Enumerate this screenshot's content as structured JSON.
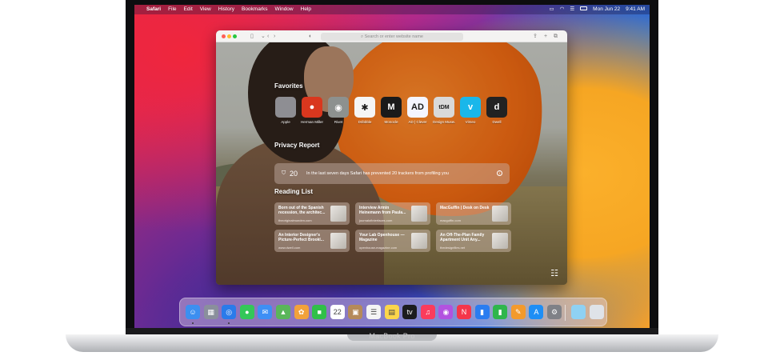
{
  "menubar": {
    "apple_glyph": "",
    "app_name": "Safari",
    "items": [
      "File",
      "Edit",
      "View",
      "History",
      "Bookmarks",
      "Window",
      "Help"
    ],
    "date": "Mon Jun 22",
    "time": "9:41 AM"
  },
  "safari": {
    "address_placeholder": "Search or enter website name",
    "favorites_title": "Favorites",
    "favorites": [
      {
        "label": "Apple",
        "glyph": "",
        "color": "#8e8e93"
      },
      {
        "label": "Herman Miller",
        "glyph": "●",
        "color": "#d9371e"
      },
      {
        "label": "Rivet",
        "glyph": "◉",
        "color": "#8d918f"
      },
      {
        "label": "Dribbble",
        "glyph": "✱",
        "color": "#f5f5f5"
      },
      {
        "label": "Monocle",
        "glyph": "M",
        "color": "#1a1a1a"
      },
      {
        "label": "AD | Clever",
        "glyph": "AD",
        "color": "#f4f5ff"
      },
      {
        "label": "Design Museum",
        "glyph": "tDM",
        "color": "#d9d9d9"
      },
      {
        "label": "Vimeo",
        "glyph": "v",
        "color": "#1ab7ea"
      },
      {
        "label": "Dwell",
        "glyph": "d",
        "color": "#222222"
      }
    ],
    "privacy_title": "Privacy Report",
    "privacy_count": "20",
    "privacy_text": "In the last seven days Safari has prevented 20 trackers from profiling you",
    "reading_title": "Reading List",
    "reading_list": [
      {
        "title": "Born out of the Spanish recession, the architec...",
        "site": "theoriginalmunden.com"
      },
      {
        "title": "Interview Armin Heinemann from Paula...",
        "site": "journalofinterfaces.com"
      },
      {
        "title": "MacGuffin | Desk on Desk",
        "site": "macguffin.com"
      },
      {
        "title": "An Interior Designer's Picture-Perfect Brookl...",
        "site": "www.dwell.com"
      },
      {
        "title": "Your Lab Openhouse — Magazine",
        "site": "openhouse-magazine.com"
      },
      {
        "title": "An Off-The-Plan Family Apartment Unit Any...",
        "site": "thedesignfiles.net"
      }
    ]
  },
  "dock": {
    "icons": [
      {
        "name": "finder",
        "color": "#3c8ff0",
        "glyph": "☺"
      },
      {
        "name": "launchpad",
        "color": "#8a8f9c",
        "glyph": "▦"
      },
      {
        "name": "safari",
        "color": "#2a7bea",
        "glyph": "◎"
      },
      {
        "name": "messages",
        "color": "#34c759",
        "glyph": "●"
      },
      {
        "name": "mail",
        "color": "#3e8ff5",
        "glyph": "✉"
      },
      {
        "name": "maps",
        "color": "#5ab65a",
        "glyph": "▲"
      },
      {
        "name": "photos",
        "color": "#f2a23a",
        "glyph": "✿"
      },
      {
        "name": "facetime",
        "color": "#30c048",
        "glyph": "■"
      },
      {
        "name": "calendar",
        "color": "#ffffff",
        "glyph": "22"
      },
      {
        "name": "contacts",
        "color": "#b58a5a",
        "glyph": "▣"
      },
      {
        "name": "reminders",
        "color": "#f4f4f4",
        "glyph": "☰"
      },
      {
        "name": "notes",
        "color": "#fbd64a",
        "glyph": "▤"
      },
      {
        "name": "apple-tv",
        "color": "#1c1c1e",
        "glyph": "tv"
      },
      {
        "name": "music",
        "color": "#fb3c5c",
        "glyph": "♫"
      },
      {
        "name": "podcasts",
        "color": "#b252e0",
        "glyph": "◉"
      },
      {
        "name": "news",
        "color": "#f5364a",
        "glyph": "N"
      },
      {
        "name": "keynote",
        "color": "#2b7df0",
        "glyph": "▮"
      },
      {
        "name": "numbers",
        "color": "#2fb64c",
        "glyph": "▮"
      },
      {
        "name": "pages",
        "color": "#f39a2c",
        "glyph": "✎"
      },
      {
        "name": "app-store",
        "color": "#1e8ef5",
        "glyph": "A"
      },
      {
        "name": "system-preferences",
        "color": "#7f8187",
        "glyph": "⚙"
      },
      {
        "name": "downloads-folder",
        "color": "#8fd1f3",
        "glyph": ""
      },
      {
        "name": "trash",
        "color": "#dfe3e8",
        "glyph": ""
      }
    ]
  },
  "device": {
    "brand": "MacBook Pro"
  }
}
